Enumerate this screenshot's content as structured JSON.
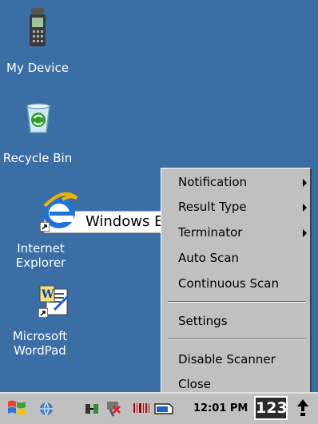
{
  "desktop": {
    "icons": [
      {
        "label": "My Device"
      },
      {
        "label": "Recycle Bin"
      },
      {
        "label": "Internet\nExplorer"
      },
      {
        "label": "Microsoft\nWordPad"
      }
    ],
    "ie_banner_text": "Windows E"
  },
  "menu": {
    "items": [
      {
        "label": "Notification",
        "submenu": true
      },
      {
        "label": "Result Type",
        "submenu": true
      },
      {
        "label": "Terminator",
        "submenu": true
      },
      {
        "label": "Auto Scan",
        "submenu": false
      },
      {
        "label": "Continuous Scan",
        "submenu": false
      },
      {
        "label": "Settings",
        "submenu": false
      },
      {
        "label": "Disable Scanner",
        "submenu": false
      },
      {
        "label": "Close",
        "submenu": false
      }
    ]
  },
  "taskbar": {
    "clock": "12:01 PM",
    "input_mode": "123",
    "icons": [
      "start-flag-icon",
      "network-icon",
      "connection-icon",
      "scanner-icon",
      "barcode-icon",
      "battery-icon",
      "arrow-up-icon"
    ]
  },
  "colors": {
    "desktop": "#3a6ea5",
    "menu": "#c0c0c0",
    "taskbar": "#c0c0c0"
  }
}
